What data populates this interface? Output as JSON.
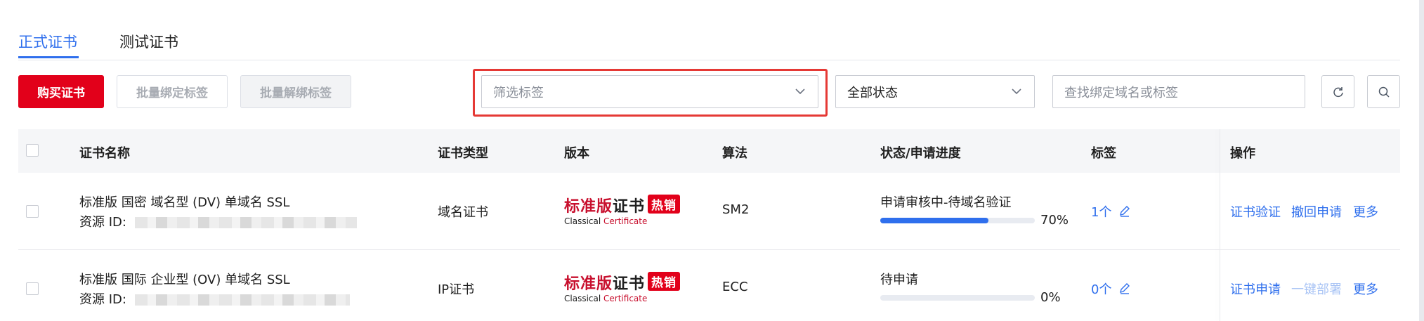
{
  "tabs": [
    {
      "label": "正式证书",
      "active": true
    },
    {
      "label": "测试证书",
      "active": false
    }
  ],
  "toolbar": {
    "buy_label": "购买证书",
    "bind_label": "批量绑定标签",
    "unbind_label": "批量解绑标签",
    "tag_filter_placeholder": "筛选标签",
    "status_select_value": "全部状态",
    "search_placeholder": "查找绑定域名或标签"
  },
  "table": {
    "headers": [
      "证书名称",
      "证书类型",
      "版本",
      "算法",
      "状态/申请进度",
      "标签",
      "操作"
    ],
    "rows": [
      {
        "name": "标准版 国密 域名型 (DV) 单域名 SSL",
        "resource_label": "资源 ID:",
        "type": "域名证书",
        "version_main_red": "标准版",
        "version_main_dark": "证书",
        "version_hot": "热销",
        "version_sub_dark": "Classical",
        "version_sub_red": "Certificate",
        "algorithm": "SM2",
        "status": "申请审核中-待域名验证",
        "progress": 0.7,
        "progress_label": "70%",
        "tags": "1个",
        "actions": [
          "证书验证",
          "撤回申请",
          "更多"
        ]
      },
      {
        "name": "标准版 国际 企业型 (OV) 单域名 SSL",
        "resource_label": "资源 ID:",
        "type": "IP证书",
        "version_main_red": "标准版",
        "version_main_dark": "证书",
        "version_hot": "热销",
        "version_sub_dark": "Classical",
        "version_sub_red": "Certificate",
        "algorithm": "ECC",
        "status": "待申请",
        "progress": 0.0,
        "progress_label": "0%",
        "tags": "0个",
        "actions": [
          "证书申请",
          "一键部署",
          "更多"
        ]
      }
    ]
  },
  "colors": {
    "accent": "#2f6fed",
    "brand_red": "#e2001a",
    "highlight": "#e53935"
  },
  "icons": [
    "chevron-down-icon",
    "refresh-icon",
    "search-icon",
    "edit-pencil-icon"
  ]
}
